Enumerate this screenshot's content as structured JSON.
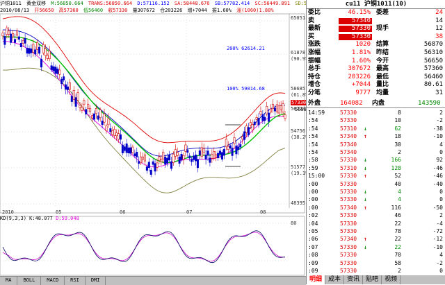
{
  "header": {
    "line1": [
      "沪铜1011",
      "黄金双移",
      "M:56850.664",
      "TRANS:56850.664",
      "D:57116.152",
      "SA:58448.676",
      "SB:57782.414",
      "SC:56449.891",
      "SD:55783.629"
    ],
    "line2": [
      "2010/08/13",
      "开56650",
      "高57360",
      "低56460",
      "收57330",
      "量307672",
      "仓203226",
      "增+7044",
      "振1.60%",
      "涨(1060)1.88%"
    ]
  },
  "main_chart": {
    "y_labels": [
      "65051",
      "61878",
      "(90.9%)",
      "58685",
      "(61.8%)",
      "56723",
      "54756",
      "(38.2%)",
      "51577",
      "(19.1%)",
      "48395"
    ],
    "x_labels": [
      "2010",
      "05",
      "06",
      "07",
      "08"
    ],
    "annotations": [
      "200% 62614.21",
      "100% 59014.68",
      "56985"
    ],
    "last_price_tag": "57330",
    "colors": {
      "upper_band": "#e00000",
      "mid_band": "#00c000",
      "lower_band": "#808040",
      "ma_blue": "#0000c0",
      "ma_magenta": "#e000e0",
      "candle_up": "#d00000",
      "candle_down": "#0000c8"
    }
  },
  "kdj": {
    "label": "KD(9,3,3)",
    "k_value": "K:48.077",
    "d_value": "D:59.048",
    "y_label": "80"
  },
  "bottom_tabs": [
    "MA",
    "BOLL",
    "MACD",
    "RSI",
    "DMI"
  ],
  "quote": {
    "title": "cu11 沪铜1011(10)",
    "rows": [
      {
        "l1": "委比",
        "v1": "46.15%",
        "l2": "委差",
        "v2": "24"
      },
      {
        "l1": "卖",
        "v1": "57340",
        "l2": "",
        "v2": "14"
      },
      {
        "l1": "最新",
        "v1": "57330",
        "l2": "现手",
        "v2": "12"
      },
      {
        "l1": "买",
        "v1": "57330",
        "l2": "",
        "v2": "38"
      },
      {
        "l1": "涨跌",
        "v1": "1020",
        "l2": "结算",
        "v2": "56870"
      },
      {
        "l1": "涨幅",
        "v1": "1.81%",
        "l2": "昨结",
        "v2": "56310"
      },
      {
        "l1": "振幅",
        "v1": "1.60%",
        "l2": "今开",
        "v2": "56650"
      },
      {
        "l1": "总手",
        "v1": "307672",
        "l2": "最高",
        "v2": "57360"
      },
      {
        "l1": "持仓",
        "v1": "203226",
        "l2": "最低",
        "v2": "56460"
      },
      {
        "l1": "增仓",
        "v1": "+7044",
        "l2": "量比",
        "v2": "80.61"
      },
      {
        "l1": "分笔",
        "v1": "9777",
        "l2": "均量",
        "v2": "31"
      }
    ],
    "waipan_label": "外盘",
    "waipan_value": "164082",
    "neipan_label": "内盘",
    "neipan_value": "143590"
  },
  "ticks": [
    {
      "t": "14:59",
      "p": "57330",
      "a": "",
      "v": "8",
      "d": "2",
      "c": "red"
    },
    {
      "t": ":54",
      "p": "57330",
      "a": "",
      "v": "10",
      "d": "-2",
      "c": "red"
    },
    {
      "t": ":54",
      "p": "57310",
      "a": "↓",
      "v": "62",
      "d": "-38",
      "c": "red"
    },
    {
      "t": ":54",
      "p": "57340",
      "a": "↑",
      "v": "18",
      "d": "-10",
      "c": "red"
    },
    {
      "t": ":54",
      "p": "57340",
      "a": "",
      "v": "30",
      "d": "4",
      "c": "red"
    },
    {
      "t": ":54",
      "p": "57340",
      "a": "",
      "v": "2",
      "d": "0",
      "c": "red"
    },
    {
      "t": ":58",
      "p": "57330",
      "a": "↓",
      "v": "166",
      "d": "92",
      "c": "red"
    },
    {
      "t": ":59",
      "p": "57310",
      "a": "↓",
      "v": "128",
      "d": "-46",
      "c": "red"
    },
    {
      "t": "15:00",
      "p": "57330",
      "a": "↑",
      "v": "52",
      "d": "-46",
      "c": "red"
    },
    {
      "t": ":00",
      "p": "57330",
      "a": "",
      "v": "40",
      "d": "-40",
      "c": "red"
    },
    {
      "t": ":00",
      "p": "57330",
      "a": "↓",
      "v": "4",
      "d": "0",
      "c": "red"
    },
    {
      "t": ":00",
      "p": "57330",
      "a": "↓",
      "v": "4",
      "d": "0",
      "c": "red"
    },
    {
      "t": ":00",
      "p": "57340",
      "a": "↑",
      "v": "116",
      "d": "-50",
      "c": "red"
    },
    {
      "t": ":02",
      "p": "57330",
      "a": "",
      "v": "46",
      "d": "2",
      "c": "red"
    },
    {
      "t": ":04",
      "p": "57330",
      "a": "",
      "v": "22",
      "d": "-4",
      "c": "red"
    },
    {
      "t": ":05",
      "p": "57330",
      "a": "",
      "v": "78",
      "d": "-72",
      "c": "red"
    },
    {
      "t": ":06",
      "p": "57340",
      "a": "↑",
      "v": "22",
      "d": "-12",
      "c": "red"
    },
    {
      "t": ":07",
      "p": "57330",
      "a": "↓",
      "v": "22",
      "d": "-10",
      "c": "red"
    },
    {
      "t": ":08",
      "p": "57330",
      "a": "",
      "v": "70",
      "d": "4",
      "c": "red"
    },
    {
      "t": ":09",
      "p": "57330",
      "a": "",
      "v": "58",
      "d": "-2",
      "c": "red"
    },
    {
      "t": ":09",
      "p": "57330",
      "a": "",
      "v": "2",
      "d": "0",
      "c": "red"
    }
  ],
  "right_tabs": [
    "明细",
    "成本",
    "资讯",
    "贴吧",
    "视频"
  ]
}
